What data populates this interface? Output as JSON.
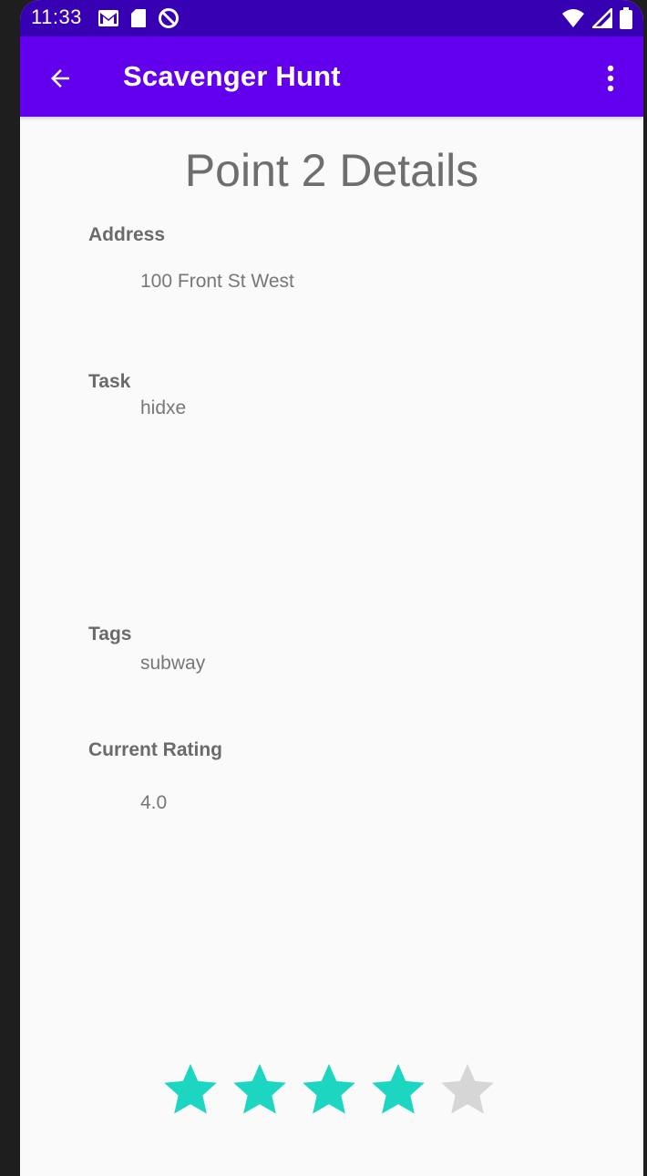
{
  "status_bar": {
    "time": "11:33",
    "icons_left": [
      "gmail-icon",
      "sd-card-icon",
      "do-not-disturb-icon"
    ],
    "icons_right": [
      "wifi-icon",
      "signal-icon",
      "battery-icon"
    ]
  },
  "app_bar": {
    "title": "Scavenger Hunt",
    "back_icon": "arrow-back-icon",
    "overflow_icon": "more-vert-icon"
  },
  "details": {
    "title": "Point 2 Details",
    "address_label": "Address",
    "address_value": "100 Front St West",
    "task_label": "Task",
    "task_value": "hidxe",
    "tags_label": "Tags",
    "tags_value": "subway",
    "rating_label": "Current Rating",
    "rating_value": "4.0"
  },
  "rating_bar": {
    "rating": 4,
    "max": 5,
    "filled_color": "#1dd6c2",
    "empty_color": "#d6d6d6"
  },
  "colors": {
    "status_bar": "#3700b3",
    "app_bar": "#6200ee"
  }
}
